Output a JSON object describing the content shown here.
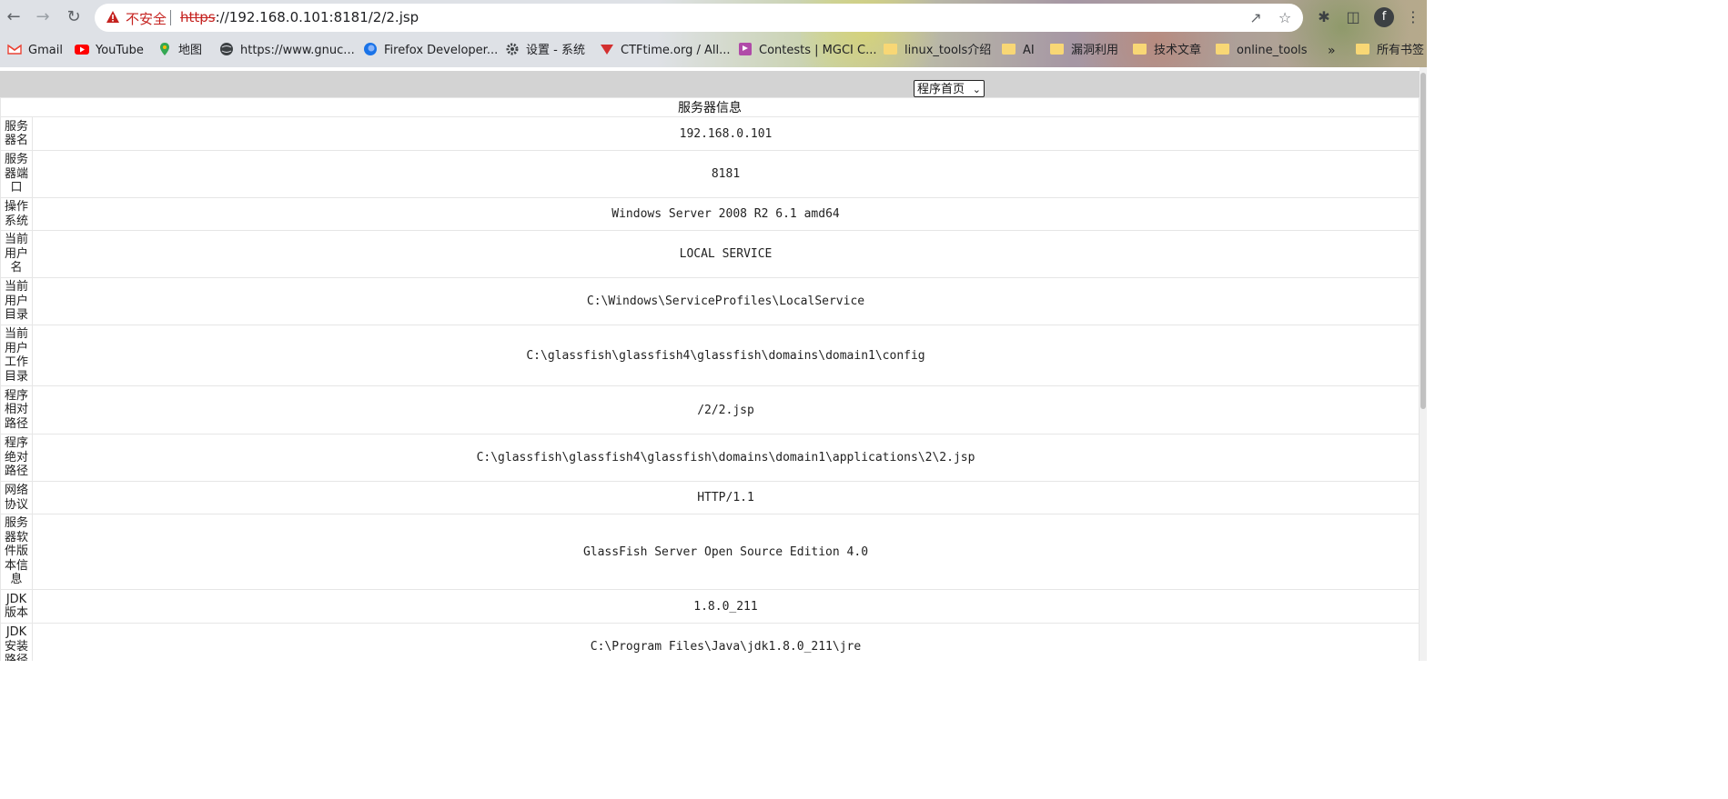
{
  "browser": {
    "not_secure_label": "不安全",
    "url_proto": "https",
    "url_rest": "://192.168.0.101:8181/2/2.jsp",
    "profile_initial": "f"
  },
  "bookmarks": [
    {
      "label": "Gmail",
      "icon": "gmail-icon"
    },
    {
      "label": "YouTube",
      "icon": "youtube-icon"
    },
    {
      "label": "地图",
      "icon": "maps-icon"
    },
    {
      "label": "https://www.gnuc...",
      "icon": "globe-icon"
    },
    {
      "label": "Firefox Developer...",
      "icon": "firefox-icon"
    },
    {
      "label": "设置 - 系统",
      "icon": "gear-icon"
    },
    {
      "label": "CTFtime.org / All...",
      "icon": "ctftime-icon"
    },
    {
      "label": "Contests | MGCI C...",
      "icon": "flag-icon"
    },
    {
      "label": "linux_tools介绍",
      "icon": "folder-icon"
    },
    {
      "label": "AI",
      "icon": "folder-icon"
    },
    {
      "label": "漏洞利用",
      "icon": "folder-icon"
    },
    {
      "label": "技术文章",
      "icon": "folder-icon"
    },
    {
      "label": "online_tools",
      "icon": "folder-icon"
    }
  ],
  "bookmarks_overflow": "»",
  "all_bookmarks": "所有书签",
  "page": {
    "select_value": "程序首页",
    "table_title": "服务器信息",
    "rows": [
      {
        "key": "服务器名",
        "value": "192.168.0.101"
      },
      {
        "key": "服务器端口",
        "value": "8181"
      },
      {
        "key": "操作系统",
        "value": "Windows Server 2008 R2 6.1 amd64"
      },
      {
        "key": "当前用户名",
        "value": "LOCAL SERVICE"
      },
      {
        "key": "当前用户目录",
        "value": "C:\\Windows\\ServiceProfiles\\LocalService"
      },
      {
        "key": "当前用户工作目录",
        "value": "C:\\glassfish\\glassfish4\\glassfish\\domains\\domain1\\config"
      },
      {
        "key": "程序相对路径",
        "value": "/2/2.jsp"
      },
      {
        "key": "程序绝对路径",
        "value": "C:\\glassfish\\glassfish4\\glassfish\\domains\\domain1\\applications\\2\\2.jsp"
      },
      {
        "key": "网络协议",
        "value": "HTTP/1.1"
      },
      {
        "key": "服务器软件版本信息",
        "value": "GlassFish Server Open Source Edition 4.0"
      },
      {
        "key": "JDK版本",
        "value": "1.8.0_211"
      },
      {
        "key": "JDK安装路径",
        "value": "C:\\Program Files\\Java\\jdk1.8.0_211\\jre"
      }
    ]
  }
}
